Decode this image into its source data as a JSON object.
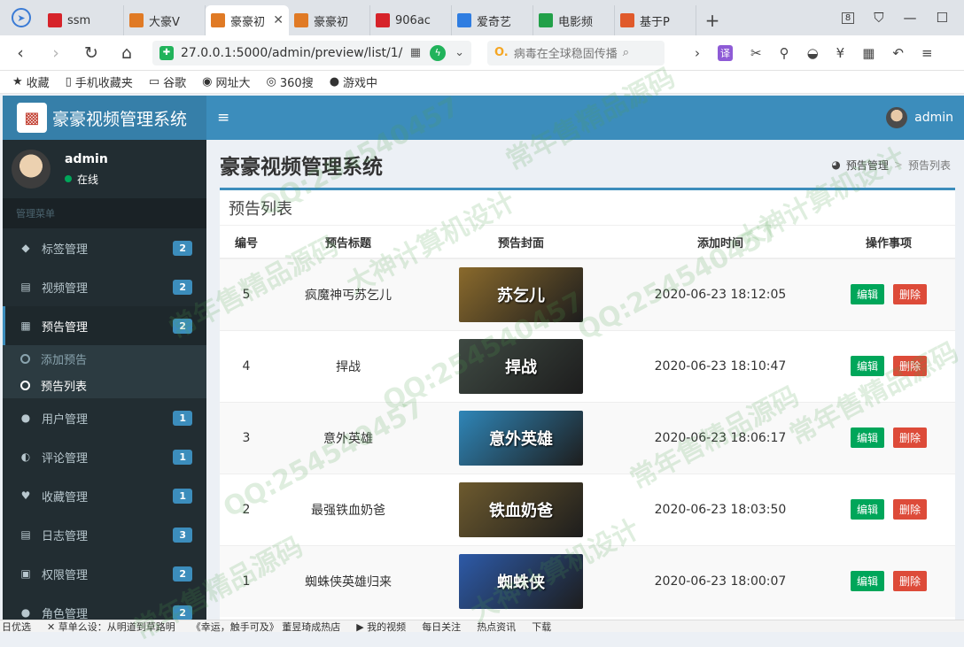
{
  "browser": {
    "tabs": [
      {
        "label": "ssm",
        "fav_color": "#d6232a"
      },
      {
        "label": "大豪V",
        "fav_color": "#e07a25"
      },
      {
        "label": "豪豪初",
        "fav_color": "#e07a25",
        "active": true
      },
      {
        "label": "豪豪初",
        "fav_color": "#e07a25"
      },
      {
        "label": "906ac",
        "fav_color": "#d6232a"
      },
      {
        "label": "爱奇艺",
        "fav_color": "#2f7de1"
      },
      {
        "label": "电影频",
        "fav_color": "#22a049"
      },
      {
        "label": "基于P",
        "fav_color": "#e05a2b"
      }
    ],
    "tab_close": "✕",
    "new_tab": "+",
    "url": "27.0.0.1:5000/admin/preview/list/1/",
    "search_text": "病毒在全球稳固传播",
    "bookmarks": [
      {
        "label": "收藏",
        "icon": "★"
      },
      {
        "label": "手机收藏夹",
        "icon": "▯"
      },
      {
        "label": "谷歌",
        "icon": "▭"
      },
      {
        "label": "网址大",
        "icon": "◉"
      },
      {
        "label": "360搜",
        "icon": "◎"
      },
      {
        "label": "游戏中",
        "icon": "●"
      }
    ]
  },
  "app": {
    "brand": "豪豪视频管理系统",
    "top_user": "admin",
    "hamburger": "≡"
  },
  "sidebar": {
    "user_name": "admin",
    "user_status": "在线",
    "menu_header": "管理菜单",
    "items": [
      {
        "label": "标签管理",
        "icon": "tag-icon",
        "glyph": "◆",
        "count": "2"
      },
      {
        "label": "视频管理",
        "icon": "file-video-icon",
        "glyph": "▤",
        "count": "2"
      },
      {
        "label": "预告管理",
        "icon": "film-icon",
        "glyph": "▦",
        "count": "2",
        "active": true
      },
      {
        "label": "用户管理",
        "icon": "users-icon",
        "glyph": "●",
        "count": "1"
      },
      {
        "label": "评论管理",
        "icon": "comments-icon",
        "glyph": "◐",
        "count": "1"
      },
      {
        "label": "收藏管理",
        "icon": "heart-icon",
        "glyph": "♥",
        "count": "1"
      },
      {
        "label": "日志管理",
        "icon": "file-text-icon",
        "glyph": "▤",
        "count": "3"
      },
      {
        "label": "权限管理",
        "icon": "lock-icon",
        "glyph": "▣",
        "count": "2"
      },
      {
        "label": "角色管理",
        "icon": "user-icon",
        "glyph": "●",
        "count": "2"
      }
    ],
    "submenu": [
      {
        "label": "添加预告"
      },
      {
        "label": "预告列表",
        "active": true
      }
    ]
  },
  "content": {
    "page_title": "豪豪视频管理系统",
    "breadcrumb": [
      "预告管理",
      "预告列表"
    ],
    "breadcrumb_sep": ">",
    "box_title": "预告列表",
    "columns": [
      "编号",
      "预告标题",
      "预告封面",
      "添加时间",
      "操作事项"
    ],
    "edit_label": "编辑",
    "delete_label": "删除",
    "rows": [
      {
        "id": "5",
        "title": "疯魔神丐苏乞儿",
        "cover_text": "苏乞儿",
        "cover_color": "#8a6a2c",
        "time": "2020-06-23 18:12:05"
      },
      {
        "id": "4",
        "title": "捍战",
        "cover_text": "捍战",
        "cover_color": "#3f4a43",
        "time": "2020-06-23 18:10:47"
      },
      {
        "id": "3",
        "title": "意外英雄",
        "cover_text": "意外英雄",
        "cover_color": "#2f86b8",
        "time": "2020-06-23 18:06:17"
      },
      {
        "id": "2",
        "title": "最强铁血奶爸",
        "cover_text": "铁血奶爸",
        "cover_color": "#6d5a2e",
        "time": "2020-06-23 18:03:50"
      },
      {
        "id": "1",
        "title": "蜘蛛侠英雄归来",
        "cover_text": "蜘蛛侠",
        "cover_color": "#2d5aa8",
        "time": "2020-06-23 18:00:07"
      }
    ]
  },
  "statusbar": [
    "日优选",
    "✕ 草单么设：从明道到草路明",
    "《幸运，触手可及》 董昱琦成热店",
    "▶ 我的视频",
    "每日关注",
    "热点资讯",
    "下载"
  ],
  "watermarks": [
    "QQ:254540457",
    "常年售精品源码",
    "大神计算机设计"
  ]
}
